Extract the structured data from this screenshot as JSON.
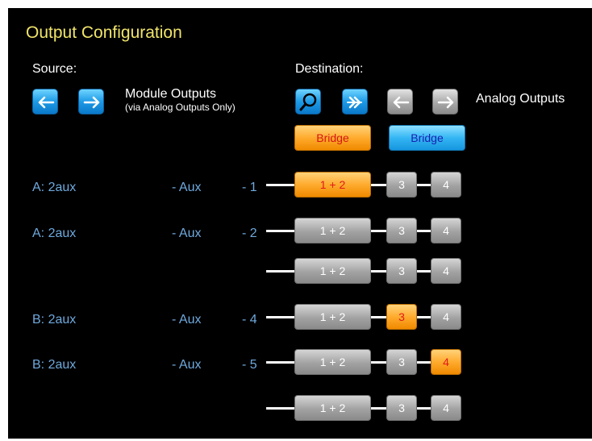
{
  "title": "Output Configuration",
  "source": {
    "label": "Source:",
    "module_outputs": "Module Outputs",
    "module_note": "(via Analog Outputs Only)"
  },
  "destination": {
    "label": "Destination:",
    "analog_outputs": "Analog Outputs"
  },
  "bridges": {
    "left": {
      "label": "Bridge",
      "state": "active-orange"
    },
    "right": {
      "label": "Bridge",
      "state": "active-blue"
    }
  },
  "buttons": {
    "b12": "1 + 2",
    "b3": "3",
    "b4": "4"
  },
  "rows": [
    {
      "source": "A: 2aux",
      "aux": "- Aux",
      "num": "- 1",
      "active": "b12"
    },
    {
      "source": "A: 2aux",
      "aux": "- Aux",
      "num": "- 2",
      "active": ""
    },
    {
      "source": "",
      "aux": "",
      "num": "",
      "active": ""
    },
    {
      "source": "B: 2aux",
      "aux": "- Aux",
      "num": "- 4",
      "active": "b3"
    },
    {
      "source": "B: 2aux",
      "aux": "- Aux",
      "num": "- 5",
      "active": "b4"
    },
    {
      "source": "",
      "aux": "",
      "num": "",
      "active": ""
    }
  ],
  "colors": {
    "title": "#f0e46a",
    "source_text": "#6fa9dd",
    "active_orange": "#ffab2e",
    "inactive_gray": "#a2a2a2",
    "blue_button": "#1d9ae6"
  }
}
